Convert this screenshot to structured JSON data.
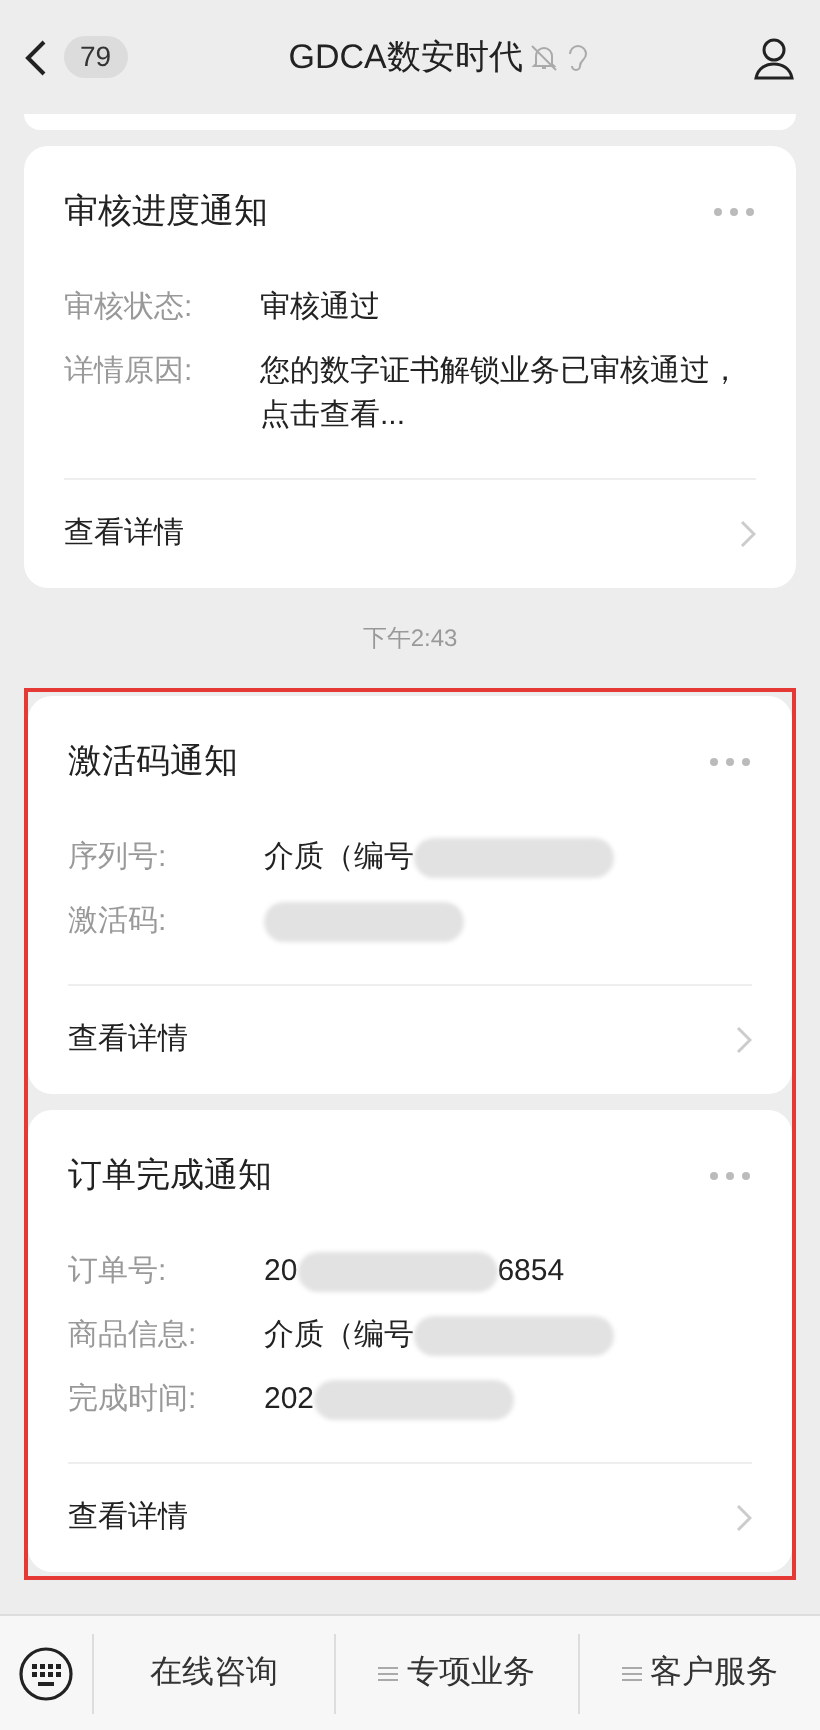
{
  "header": {
    "back_count": "79",
    "title": "GDCA数安时代"
  },
  "feed": [
    {
      "kind": "card",
      "title": "审核进度通知",
      "fields": [
        {
          "label": "审核状态:",
          "parts": [
            {
              "kind": "text",
              "text": "审核通过"
            }
          ]
        },
        {
          "label": "详情原因:",
          "parts": [
            {
              "kind": "text",
              "text": "您的数字证书解锁业务已审核通过，点击查看..."
            }
          ]
        }
      ],
      "link": "查看详情"
    },
    {
      "kind": "time",
      "text": "下午2:43"
    },
    {
      "kind": "highlight",
      "cards": [
        {
          "title": "激活码通知",
          "fields": [
            {
              "label": "序列号:",
              "parts": [
                {
                  "kind": "text",
                  "text": "介质（编号"
                },
                {
                  "kind": "redacted"
                }
              ]
            },
            {
              "label": "激活码:",
              "parts": [
                {
                  "kind": "redacted"
                }
              ]
            }
          ],
          "link": "查看详情"
        },
        {
          "title": "订单完成通知",
          "fields": [
            {
              "label": "订单号:",
              "parts": [
                {
                  "kind": "text",
                  "text": "20"
                },
                {
                  "kind": "redacted"
                },
                {
                  "kind": "text",
                  "text": "6854"
                }
              ]
            },
            {
              "label": "商品信息:",
              "parts": [
                {
                  "kind": "text",
                  "text": "介质（编号"
                },
                {
                  "kind": "redacted"
                }
              ]
            },
            {
              "label": "完成时间:",
              "parts": [
                {
                  "kind": "text",
                  "text": "202"
                },
                {
                  "kind": "redacted"
                }
              ]
            }
          ],
          "link": "查看详情"
        }
      ]
    }
  ],
  "menu": [
    {
      "label": "在线咨询",
      "has_submenu": false
    },
    {
      "label": "专项业务",
      "has_submenu": true
    },
    {
      "label": "客户服务",
      "has_submenu": true
    }
  ]
}
